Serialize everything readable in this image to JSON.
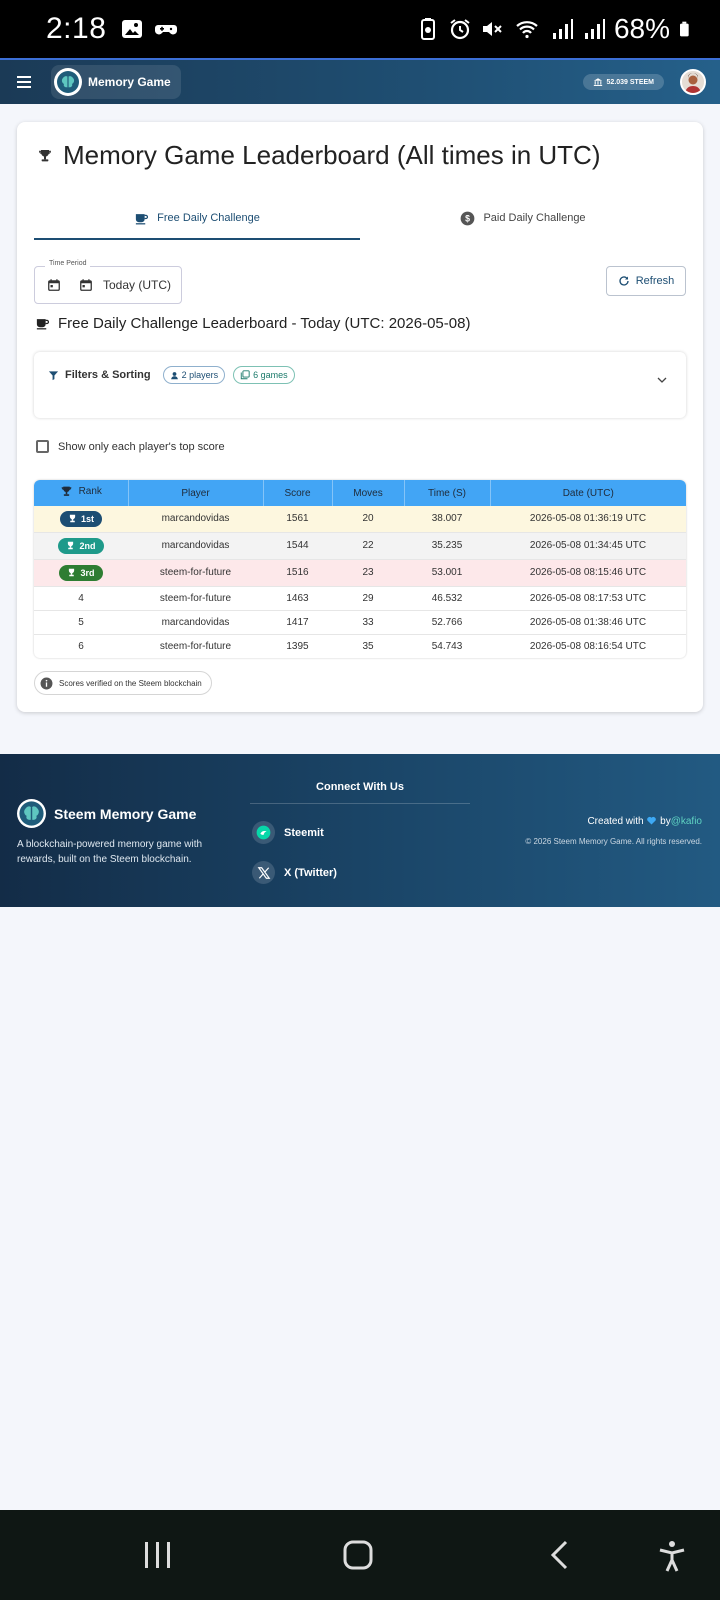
{
  "status_bar": {
    "time": "2:18",
    "battery": "68%"
  },
  "app_bar": {
    "title": "Memory Game",
    "wallet": "52.039 STEEM"
  },
  "page": {
    "title": "Memory Game Leaderboard (All times in UTC)",
    "tabs": [
      {
        "label": "Free Daily Challenge",
        "active": true
      },
      {
        "label": "Paid Daily Challenge",
        "active": false
      }
    ],
    "time_period_label": "Time Period",
    "time_period_value": "Today (UTC)",
    "refresh_label": "Refresh",
    "section_title": "Free Daily Challenge Leaderboard - Today (UTC: 2026-05-08)",
    "filters": {
      "title": "Filters & Sorting",
      "players": "2 players",
      "games": "6 games"
    },
    "top_score_label": "Show only each player's top score",
    "verified_label": "Scores verified on the Steem blockchain"
  },
  "table": {
    "columns": [
      "Rank",
      "Player",
      "Score",
      "Moves",
      "Time (S)",
      "Date (UTC)"
    ],
    "rows": [
      {
        "rank": "1st",
        "player": "marcandovidas",
        "score": "1561",
        "moves": "20",
        "time": "38.007",
        "date": "2026-05-08 01:36:19 UTC"
      },
      {
        "rank": "2nd",
        "player": "marcandovidas",
        "score": "1544",
        "moves": "22",
        "time": "35.235",
        "date": "2026-05-08 01:34:45 UTC"
      },
      {
        "rank": "3rd",
        "player": "steem-for-future",
        "score": "1516",
        "moves": "23",
        "time": "53.001",
        "date": "2026-05-08 08:15:46 UTC"
      },
      {
        "rank": "4",
        "player": "steem-for-future",
        "score": "1463",
        "moves": "29",
        "time": "46.532",
        "date": "2026-05-08 08:17:53 UTC"
      },
      {
        "rank": "5",
        "player": "marcandovidas",
        "score": "1417",
        "moves": "33",
        "time": "52.766",
        "date": "2026-05-08 01:38:46 UTC"
      },
      {
        "rank": "6",
        "player": "steem-for-future",
        "score": "1395",
        "moves": "35",
        "time": "54.743",
        "date": "2026-05-08 08:16:54 UTC"
      }
    ]
  },
  "footer": {
    "brand": "Steem Memory Game",
    "description": "A blockchain-powered memory game with rewards, built on the Steem blockchain.",
    "connect_title": "Connect With Us",
    "social": [
      "Steemit",
      "X (Twitter)"
    ],
    "created_prefix": "Created with",
    "created_by": "by",
    "created_handle": "@kafio",
    "copyright": "© 2026 Steem Memory Game. All rights reserved."
  },
  "colors": {
    "header_bg": "#1f4f73",
    "table_header": "#42a5f5",
    "gold_row": "#fdf7df",
    "bronze_row": "#fde8ea",
    "badge_1": "#1d4e73",
    "badge_2": "#1e9a8a",
    "badge_3": "#2e7d32"
  },
  "icons": [
    "image-icon",
    "game-controller-icon",
    "battery-saver-icon",
    "alarm-icon",
    "mute-icon",
    "wifi-icon",
    "signal-icon",
    "battery-icon",
    "menu-icon",
    "brain-logo-icon",
    "bank-icon",
    "trophy-icon",
    "coffee-cup-icon",
    "dollar-icon",
    "calendar-icon",
    "refresh-icon",
    "filter-icon",
    "person-icon",
    "games-icon",
    "chevron-down-icon",
    "info-icon",
    "steemit-icon",
    "x-icon",
    "heart-icon",
    "recents-icon",
    "home-icon",
    "back-icon",
    "accessibility-icon"
  ]
}
